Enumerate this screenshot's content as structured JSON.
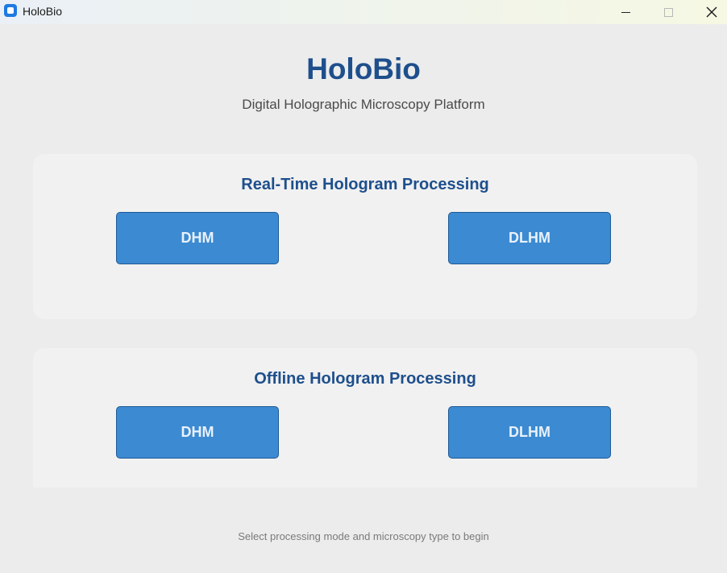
{
  "window": {
    "title": "HoloBio",
    "controls": {
      "minimize_icon": "minimize-icon",
      "maximize_icon": "maximize-icon",
      "close_icon": "close-icon",
      "close_glyph": "✕"
    }
  },
  "header": {
    "title": "HoloBio",
    "subtitle": "Digital Holographic Microscopy Platform"
  },
  "sections": [
    {
      "title": "Real-Time Hologram Processing",
      "buttons": [
        "DHM",
        "DLHM"
      ]
    },
    {
      "title": "Offline Hologram Processing",
      "buttons": [
        "DHM",
        "DLHM"
      ]
    }
  ],
  "footer": {
    "status": "Select processing mode and microscopy type to begin"
  },
  "colors": {
    "accent": "#1e4f8c",
    "button": "#3c8ad1",
    "button_border": "#1e5a96",
    "background": "#ececec",
    "panel": "#f1f1f1"
  }
}
